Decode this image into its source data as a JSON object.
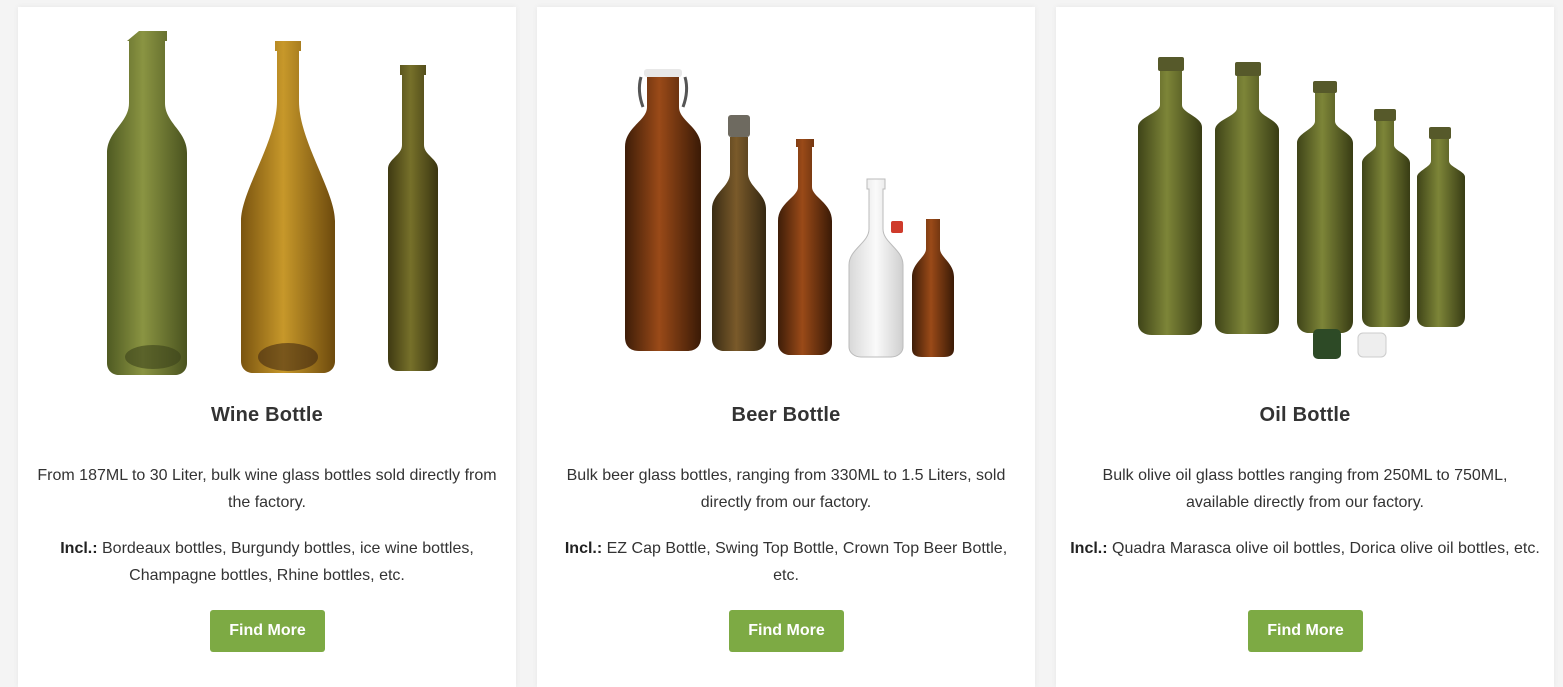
{
  "products": [
    {
      "title": "Wine Bottle",
      "description": "From 187ML to 30 Liter, bulk wine glass bottles sold directly from the factory.",
      "incl_label": "Incl.:",
      "incl_text": " Bordeaux bottles, Burgundy bottles, ice wine bottles, Champagne bottles, Rhine bottles, etc.",
      "button_label": "Find More"
    },
    {
      "title": "Beer Bottle",
      "description": "Bulk beer glass bottles, ranging from 330ML to 1.5 Liters, sold directly from our factory.",
      "incl_label": "Incl.:",
      "incl_text": " EZ Cap Bottle, Swing Top Bottle, Crown Top Beer Bottle, etc.",
      "button_label": "Find More"
    },
    {
      "title": "Oil Bottle",
      "description": "Bulk olive oil glass bottles ranging from 250ML to 750ML, available directly from our factory.",
      "incl_label": "Incl.:",
      "incl_text": " Quadra Marasca olive oil bottles, Dorica olive oil bottles, etc.",
      "button_label": "Find More"
    }
  ],
  "colors": {
    "button": "#7daa44",
    "wine_green": "#6b7330",
    "amber": "#6b3a12",
    "olive": "#5f6528"
  }
}
